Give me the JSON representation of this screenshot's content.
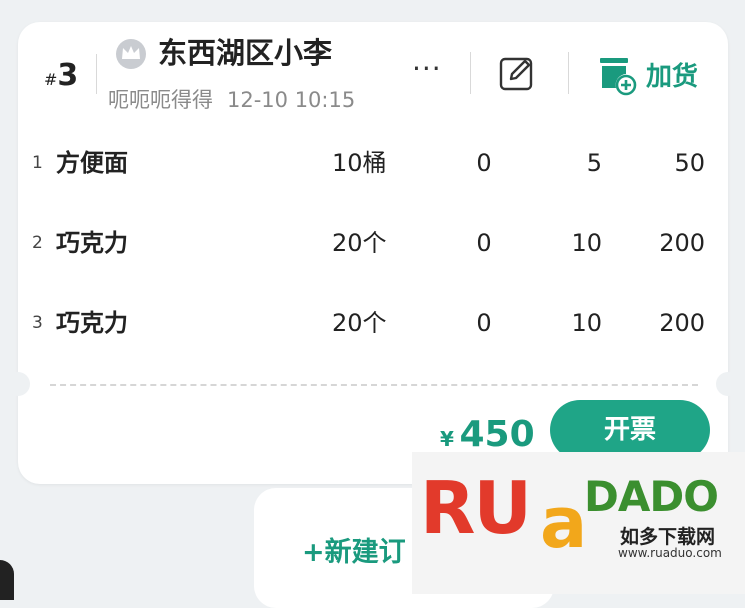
{
  "order": {
    "hash": "#",
    "number": "3",
    "customer": "东西湖区小李",
    "note": "呃呃呃得得",
    "time": "12-10 10:15",
    "more_label": "···",
    "add_goods_label": "加货"
  },
  "items": [
    {
      "index": "1",
      "name": "方便面",
      "qty": "10桶",
      "c1": "0",
      "c2": "5",
      "c3": "50"
    },
    {
      "index": "2",
      "name": "巧克力",
      "qty": "20个",
      "c1": "0",
      "c2": "10",
      "c3": "200"
    },
    {
      "index": "3",
      "name": "巧克力",
      "qty": "20个",
      "c1": "0",
      "c2": "10",
      "c3": "200"
    }
  ],
  "footer": {
    "currency": "¥",
    "total": "450",
    "invoice_label": "开票"
  },
  "new_order": {
    "label": "+新建订"
  },
  "watermark": {
    "ru": "RU",
    "a": "a",
    "duo": "DADO",
    "cn": "如多下载网",
    "url": "www.ruaduo.com"
  },
  "colors": {
    "accent": "#1a9a7e",
    "button": "#1fa587",
    "background": "#eef1f3"
  },
  "icons": [
    "crown-icon",
    "edit-icon",
    "add-goods-icon"
  ]
}
